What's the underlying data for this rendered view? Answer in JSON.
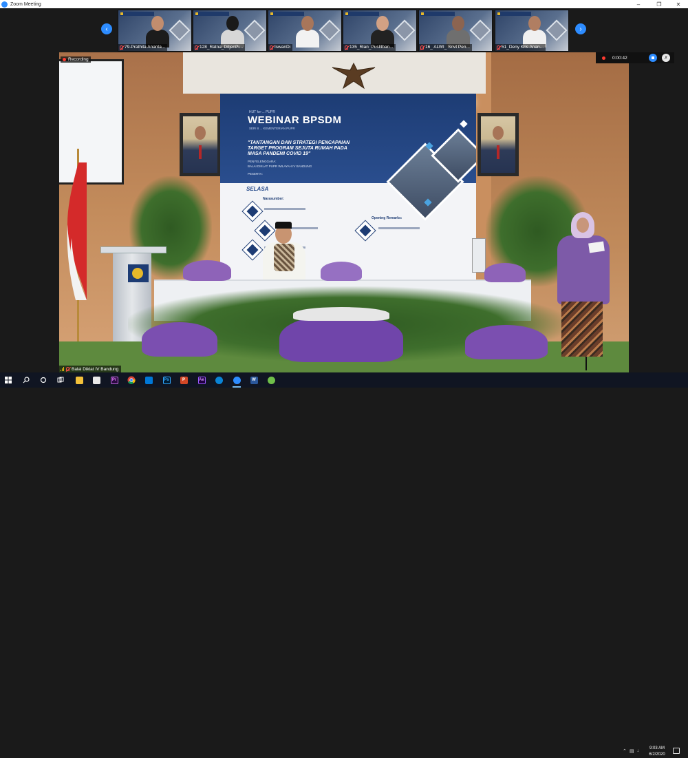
{
  "window": {
    "title": "Zoom Meeting",
    "controls": [
      "minimize",
      "restore",
      "close"
    ]
  },
  "thumbnails": {
    "prev_icon": "chevron-left-icon",
    "next_icon": "chevron-right-icon",
    "items": [
      {
        "name": "79-Prathita Ananta...",
        "muted": true
      },
      {
        "name": "128_Ratna_DitjenPi...",
        "muted": true
      },
      {
        "name": "IswanDi",
        "muted": true
      },
      {
        "name": "135_Rian_Puslitban...",
        "muted": true
      },
      {
        "name": "16_ ALWI_ Snvt Pen...",
        "muted": true
      },
      {
        "name": "51_Deny Kris Anan...",
        "muted": true
      }
    ]
  },
  "main_video": {
    "recording_label": "Recording",
    "speaker_name": "Balai Diklat IV Bandung",
    "backdrop": {
      "tag": "HUT ke-... PUPR",
      "title": "WEBINAR BPSDM",
      "subtitle": "SERI II ... KEMENTERIAN PUPR",
      "headline": "\"TANTANGAN DAN STRATEGI PENCAPAIAN TARGET PROGRAM SEJUTA RUMAH PADA MASA PANDEMI COVID 19\"",
      "venue_label": "PENYELENGGARA:",
      "venue_text": "BALAI DIKLAT PUPR WILAYAH IV BANDUNG",
      "peserta_label": "PESERTA:",
      "day": "SELASA",
      "narasumber_label": "Narasumber:",
      "opening_label": "Opening Remarks:"
    }
  },
  "recording_panel": {
    "timer": "0:00:42",
    "stop_icon": "stop-recording-icon",
    "mic_icon": "mic-muted-icon"
  },
  "taskbar": {
    "apps": [
      "windows-start-icon",
      "search-icon",
      "cortana-icon",
      "task-view-icon",
      "file-explorer-icon",
      "store-icon",
      "premiere-icon",
      "chrome-icon",
      "mail-icon",
      "photoshop-icon",
      "powerpoint-icon",
      "after-effects-icon",
      "edge-icon",
      "zoom-icon",
      "word-icon",
      "greenshot-icon"
    ],
    "time": "9:03 AM",
    "date": "6/2/2020"
  }
}
